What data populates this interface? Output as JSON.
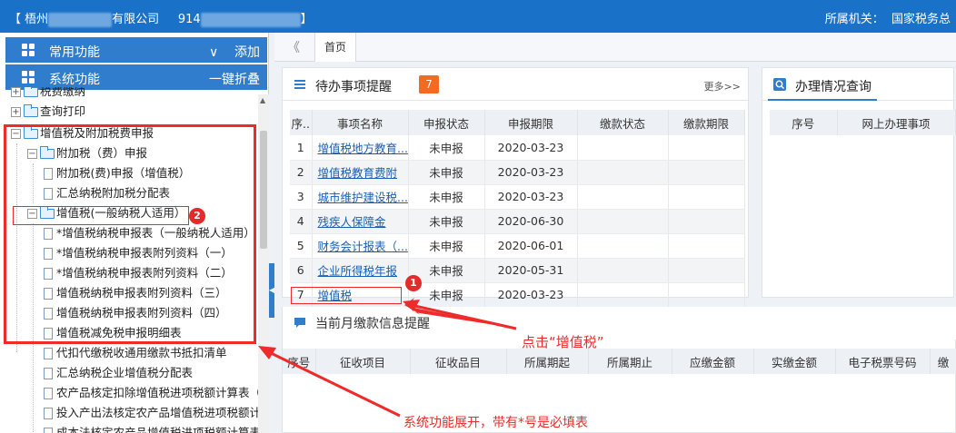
{
  "topbar": {
    "company_prefix": "【 梧州",
    "company_suffix": "有限公司",
    "taxid_prefix": "914",
    "bracket_end": "】",
    "right_label": "所属机关：",
    "right_value": "国家税务总"
  },
  "sidebar": {
    "common": {
      "label": "常用功能",
      "chevron": "∨",
      "action": "添加"
    },
    "system": {
      "label": "系统功能",
      "action": "一键折叠"
    },
    "tree": [
      {
        "label": "税费缴纳",
        "toggle": "+"
      },
      {
        "label": "查询打印",
        "toggle": "+"
      },
      {
        "label": "增值税及附加税费申报",
        "toggle": "−"
      },
      {
        "label": "附加税（费）申报",
        "toggle": "−"
      },
      {
        "label": "附加税(费)申报（增值税）"
      },
      {
        "label": "汇总纳税附加税分配表"
      },
      {
        "label": "增值税(一般纳税人适用）",
        "toggle": "−"
      },
      {
        "label": "*增值税纳税申报表（一般纳税人适用）"
      },
      {
        "label": "*增值税纳税申报表附列资料（一）"
      },
      {
        "label": "*增值税纳税申报表附列资料（二）"
      },
      {
        "label": "增值税纳税申报表附列资料（三）"
      },
      {
        "label": "增值税纳税申报表附列资料（四）"
      },
      {
        "label": "增值税减免税申报明细表"
      },
      {
        "label": "代扣代缴税收通用缴款书抵扣清单"
      },
      {
        "label": "汇总纳税企业增值税分配表"
      },
      {
        "label": "农产品核定扣除增值税进项税额计算表（"
      },
      {
        "label": "投入产出法核定农产品增值税进项税额计"
      },
      {
        "label": "成本法核定农产品增值税进项税额计算表"
      }
    ]
  },
  "tabs": {
    "back": "《",
    "home": "首页"
  },
  "todo": {
    "title": "待办事项提醒",
    "count": "7",
    "more": "更多>>",
    "columns": [
      "序..",
      "事项名称",
      "申报状态",
      "申报期限",
      "缴款状态",
      "缴款期限"
    ],
    "rows": [
      {
        "no": "1",
        "name": "增值税地方教育...",
        "status": "未申报",
        "deadline": "2020-03-23"
      },
      {
        "no": "2",
        "name": "增值税教育费附",
        "status": "未申报",
        "deadline": "2020-03-23"
      },
      {
        "no": "3",
        "name": "城市维护建设税...",
        "status": "未申报",
        "deadline": "2020-03-23"
      },
      {
        "no": "4",
        "name": "残疾人保障金",
        "status": "未申报",
        "deadline": "2020-06-30"
      },
      {
        "no": "5",
        "name": "财务会计报表（...",
        "status": "未申报",
        "deadline": "2020-06-01"
      },
      {
        "no": "6",
        "name": "企业所得税年报",
        "status": "未申报",
        "deadline": "2020-05-31"
      },
      {
        "no": "7",
        "name": "增值税",
        "status": "未申报",
        "deadline": "2020-03-23"
      }
    ]
  },
  "query": {
    "title": "办理情况查询",
    "columns": [
      "序号",
      "网上办理事项"
    ]
  },
  "payment": {
    "title": "当前月缴款信息提醒",
    "columns": [
      "序号",
      "征收项目",
      "征收品目",
      "所属期起",
      "所属期止",
      "应缴金额",
      "实缴金额",
      "电子税票号码",
      "缴"
    ]
  },
  "annotations": {
    "badge1": "1",
    "badge2": "2",
    "click_hint": "点击“增值税”",
    "system_hint": "系统功能展开，带有*号是必填表"
  },
  "colors": {
    "topbar": "#1a71c8",
    "accent": "#2f7dcc",
    "badge": "#f36a21",
    "annotation": "#ee2a2a"
  }
}
